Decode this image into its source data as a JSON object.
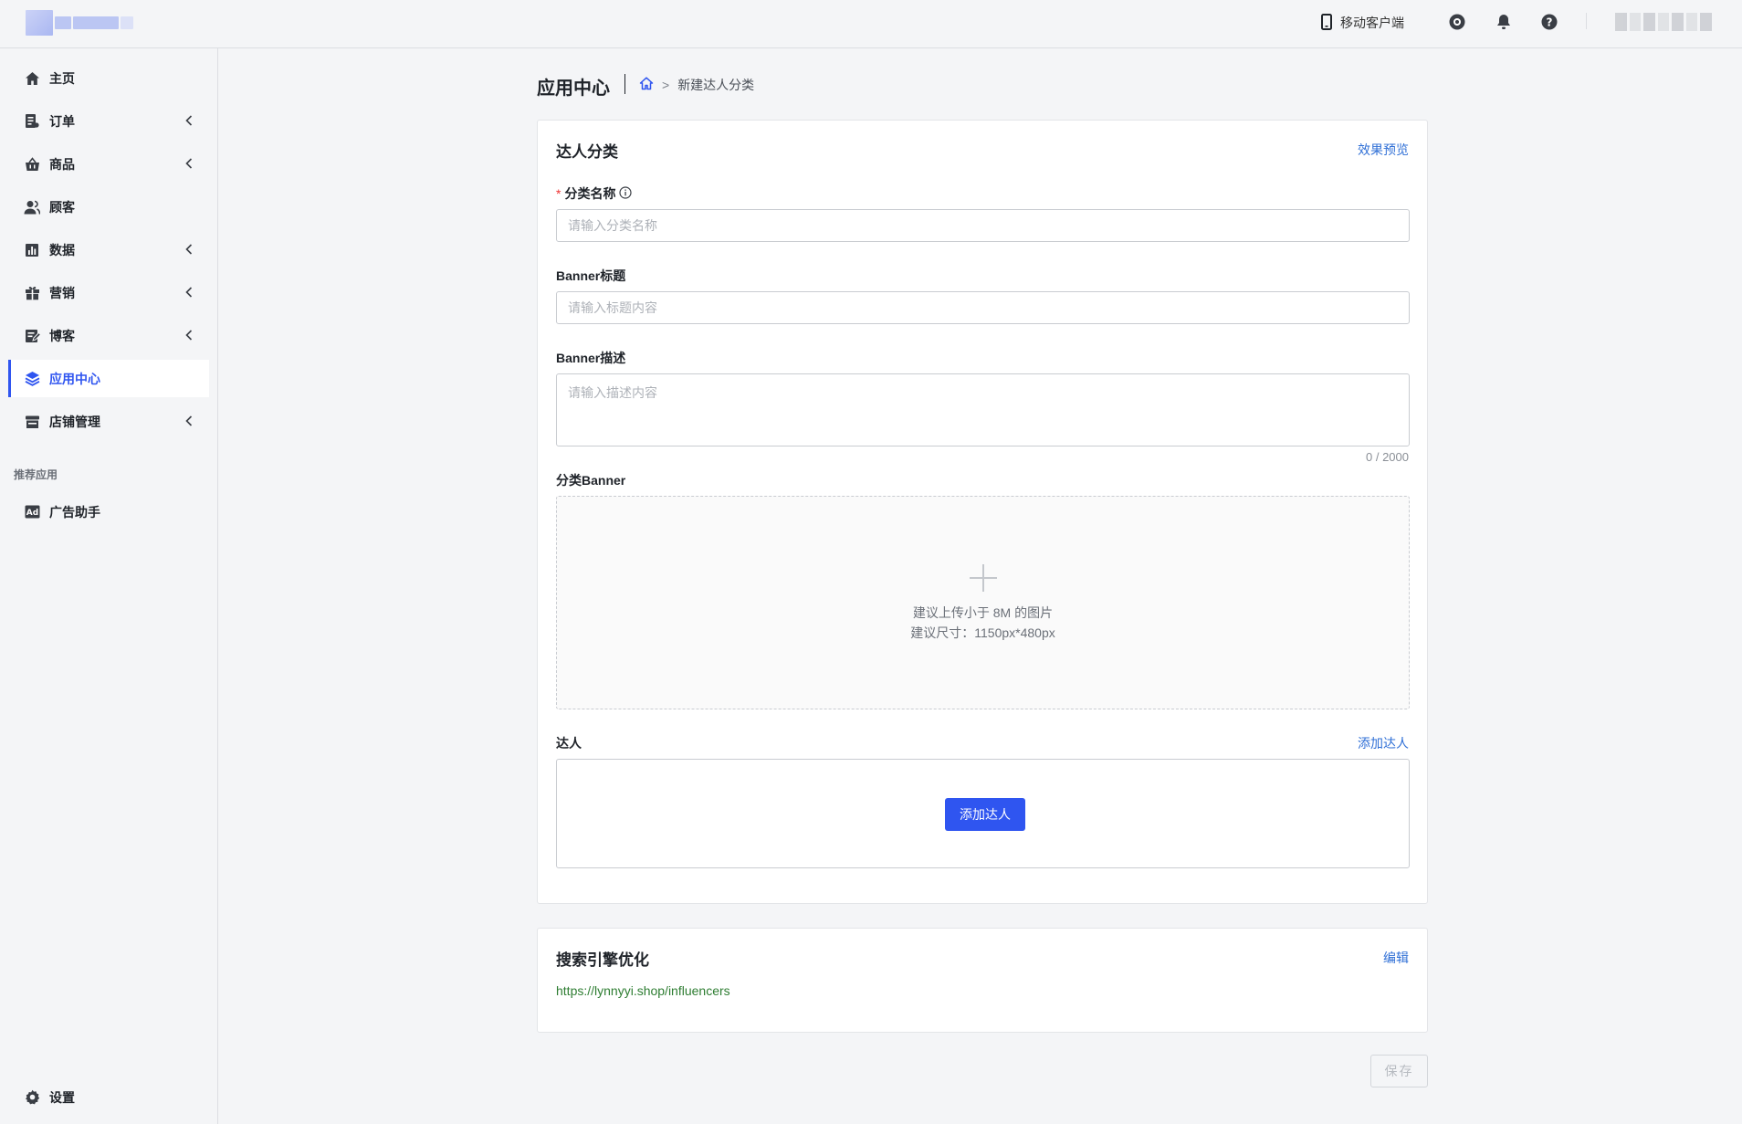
{
  "header": {
    "mobile_client_label": "移动客户端"
  },
  "sidebar": {
    "items": [
      {
        "label": "主页",
        "icon": "home-icon",
        "has_chevron": false
      },
      {
        "label": "订单",
        "icon": "order-icon",
        "has_chevron": true
      },
      {
        "label": "商品",
        "icon": "basket-icon",
        "has_chevron": true
      },
      {
        "label": "顾客",
        "icon": "customers-icon",
        "has_chevron": false
      },
      {
        "label": "数据",
        "icon": "chart-icon",
        "has_chevron": true
      },
      {
        "label": "营销",
        "icon": "gift-icon",
        "has_chevron": true
      },
      {
        "label": "博客",
        "icon": "blog-icon",
        "has_chevron": true
      },
      {
        "label": "应用中心",
        "icon": "layers-icon",
        "has_chevron": false,
        "active": true
      },
      {
        "label": "店铺管理",
        "icon": "store-icon",
        "has_chevron": true
      }
    ],
    "recommended_label": "推荐应用",
    "recommended_items": [
      {
        "label": "广告助手",
        "icon": "ad-icon"
      }
    ],
    "settings_label": "设置"
  },
  "page": {
    "title": "应用中心",
    "breadcrumb_current": "新建达人分类",
    "breadcrumb_separator": ">"
  },
  "form_card": {
    "title": "达人分类",
    "preview_link": "效果预览",
    "name_label": "分类名称",
    "name_required_mark": "*",
    "name_placeholder": "请输入分类名称",
    "banner_title_label": "Banner标题",
    "banner_title_placeholder": "请输入标题内容",
    "banner_desc_label": "Banner描述",
    "banner_desc_placeholder": "请输入描述内容",
    "banner_desc_counter": "0 / 2000",
    "banner_upload_label": "分类Banner",
    "upload_hint_size": "建议上传小于 8M 的图片",
    "upload_hint_dim": "建议尺寸：1150px*480px",
    "influencers_label": "达人",
    "add_influencer_link": "添加达人",
    "add_influencer_button": "添加达人"
  },
  "seo_card": {
    "title": "搜索引擎优化",
    "edit_link": "编辑",
    "url": "https://lynnyyi.shop/influencers"
  },
  "footer": {
    "save_label": "保存"
  },
  "colors": {
    "accent": "#2f55f0",
    "link": "#2f6fd6",
    "url_green": "#2e7d32",
    "required_red": "#ee3333"
  }
}
